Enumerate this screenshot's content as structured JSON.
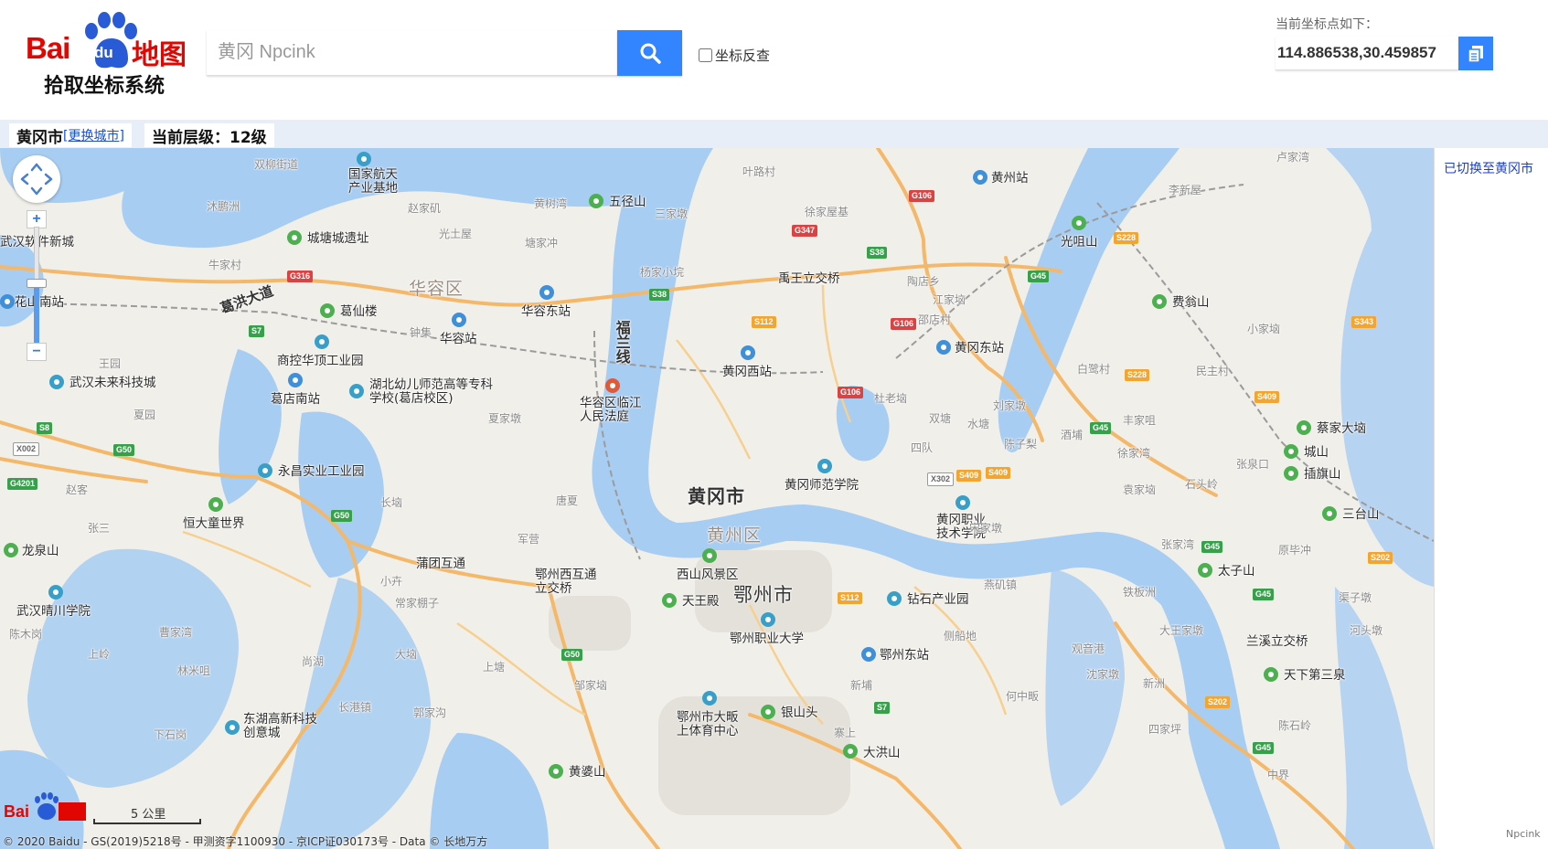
{
  "header": {
    "logo": {
      "bai": "Bai",
      "du": "du",
      "ditu": "地图",
      "subtitle": "拾取坐标系统"
    },
    "search": {
      "value": "",
      "placeholder": "黄冈 Npcink"
    },
    "search_icon": "search-icon",
    "reverse_checkbox": {
      "label": "坐标反查",
      "checked": false
    },
    "coord": {
      "label": "当前坐标点如下：",
      "value": "114.886538,30.459857"
    },
    "copy_icon": "copy-icon",
    "accent_color": "#3385ff"
  },
  "citybar": {
    "city": "黄冈市",
    "change_open": "[",
    "change_label": "更换城市",
    "change_close": "]",
    "level_label": "当前层级：",
    "level_value": "12级"
  },
  "map": {
    "labels": {
      "city_huanggang": "黄冈市",
      "district_huangzhou": "黄州区",
      "city_ezhou": "鄂州市",
      "district_huarong": "华容区",
      "road_gehong": "葛洪大道",
      "road_fulan": "福兰线",
      "hub_yuwang": "禹王立交桥",
      "hub_putuan": "蒲团互通",
      "hub_ezhou_west": "鄂州西互通立交桥",
      "hub_lanxi": "兰溪立交桥",
      "p_hgstation": "黄州站",
      "p_hgeast": "黄冈东站",
      "p_hgwest": "黄冈西站",
      "p_hgnormal": "黄冈师范学院",
      "p_hgvoc": "黄冈职业技术学院",
      "p_huarongeast": "华容东站",
      "p_huarong": "华容站",
      "p_gedian_south": "葛店南站",
      "p_ezhou_east": "鄂州东站",
      "p_ezhou_voc": "鄂州职业大学",
      "p_xishan": "西山风景区",
      "p_tianwang": "天王殿",
      "p_zuanshi": "钻石产业园",
      "p_yinshantou": "银山头",
      "p_dahongshan": "大洪山",
      "p_huangpoushan": "黄婆山",
      "p_ezhou_gym": "鄂州市大畈上体育中心",
      "p_donghu": "东湖高新科技创意城",
      "p_wuhan_qingchuan": "武汉晴川学院",
      "p_longquan": "龙泉山",
      "p_hengda": "恒大童世界",
      "p_yongchang": "永昌实业工业园",
      "p_hubei_youer": "湖北幼儿师范高等专科学校(葛店校区)",
      "p_shangkong": "商控华顶工业园",
      "p_wuhan_future": "武汉未来科技城",
      "p_gexianlou": "葛仙楼",
      "p_chengtang": "城塘城遗址",
      "p_guojia": "国家航天产业基地",
      "p_wuguishan": "五径山",
      "p_court": "华容区临江人民法庭",
      "p_guangyanshan": "光咀山",
      "p_feiwengshan": "费翁山",
      "p_caijia": "蔡家大垴",
      "p_chengshan": "城山",
      "p_chaqi": "插旗山",
      "p_santai": "三台山",
      "p_taizi": "太子山",
      "p_tianxia": "天下第三泉",
      "p_huananzhan": "花山南站",
      "p_wuhan_software": "武汉软件新城",
      "g_shuangliu": "双柳街道",
      "g_muyuan": "沐鹏洲",
      "g_zhaojiaji": "赵家矶",
      "g_guangshi": "光土屋",
      "g_tangjiachong": "塘家冲",
      "g_huangshuwan": "黄树湾",
      "g_sanjiatun": "三家墩",
      "g_yelucun": "叶路村",
      "g_xujiawu": "徐家屋基",
      "g_niujia": "牛家村",
      "g_yangjiaxiao": "杨家小垸",
      "g_taodian": "陶店乡",
      "g_jiangjiawan": "江家垴",
      "g_shaobaicun": "邵店村",
      "g_duxia": "杜老垴",
      "g_shuangtang": "双塘",
      "g_sidui": "四队",
      "g_liujiadun": "刘家墩",
      "g_chenzili": "陈子梨",
      "g_jiupu": "酒埔",
      "g_xujiawan": "徐家湾",
      "g_shiziling": "石头岭",
      "g_lijia": "李新屋",
      "g_lujia": "卢家湾",
      "g_minqiao": "民主村",
      "g_xiaojiawan": "小家垴",
      "g_bailucun": "白鹭村",
      "g_zhangwan": "张家湾",
      "g_yuan": "袁家垴",
      "g_zaoshu": "钟集",
      "g_xiaojiashan": "夏家墩",
      "g_tangqiao": "唐夏",
      "g_junwei": "军营",
      "g_xiaoshan": "小卉",
      "g_changjia": "常家棚子",
      "g_dawan": "大垴",
      "g_shangtang": "上塘",
      "g_zoujia": "邹家垴",
      "g_guojiagou": "郭家沟",
      "g_changlin": "长垴",
      "g_xiayuan": "夏园",
      "g_zhaoke": "赵客",
      "g_zhangsan": "张三",
      "g_wangyuan": "王园",
      "g_caojiawan": "曹家湾",
      "g_shangling": "上岭",
      "g_linmi": "林米咀",
      "g_chenwo": "陈木岗",
      "g_shanghu": "尚湖",
      "g_xiashiguang": "下石岗",
      "g_changjinzhen": "长港镇",
      "g_xinyuan": "新埔",
      "g_saishang": "寨上",
      "g_heyaocun": "侧船地",
      "g_yanqi": "燕矶镇",
      "g_guanyin": "观音港",
      "g_shenjia": "沈家墩",
      "g_xinzhou": "新洲",
      "g_hezhong": "何中畈",
      "g_tiebanzhou": "铁板洲",
      "g_daxiaojia": "大王家墩",
      "g_zhangkou": "张泉口",
      "g_yuanpeng": "原毕冲",
      "g_shuangqiao": "渠子墩",
      "g_sijia": "四家坪",
      "g_xilu": "河头墩",
      "g_zhongjie": "中界",
      "g_chenshi": "陈石岭",
      "g_fengjia": "丰家咀",
      "g_shuiyuan": "水塘",
      "g_xiangjia": "宋家墩"
    },
    "scale": "5 公里",
    "copyright": "© 2020 Baidu - GS(2019)5218号 - 甲测资字1100930 - 京ICP证030173号 - Data © 长地万方",
    "zoom_in": "+",
    "zoom_out": "−",
    "zoom_level_fraction": 0.53,
    "colors": {
      "water": "#a7cdf2",
      "land": "#f1efe9",
      "highway": "#f4b86a",
      "rail": "#9b9b9b"
    }
  },
  "right_panel": {
    "status": "已切换至黄冈市",
    "brand": "Npcink"
  }
}
